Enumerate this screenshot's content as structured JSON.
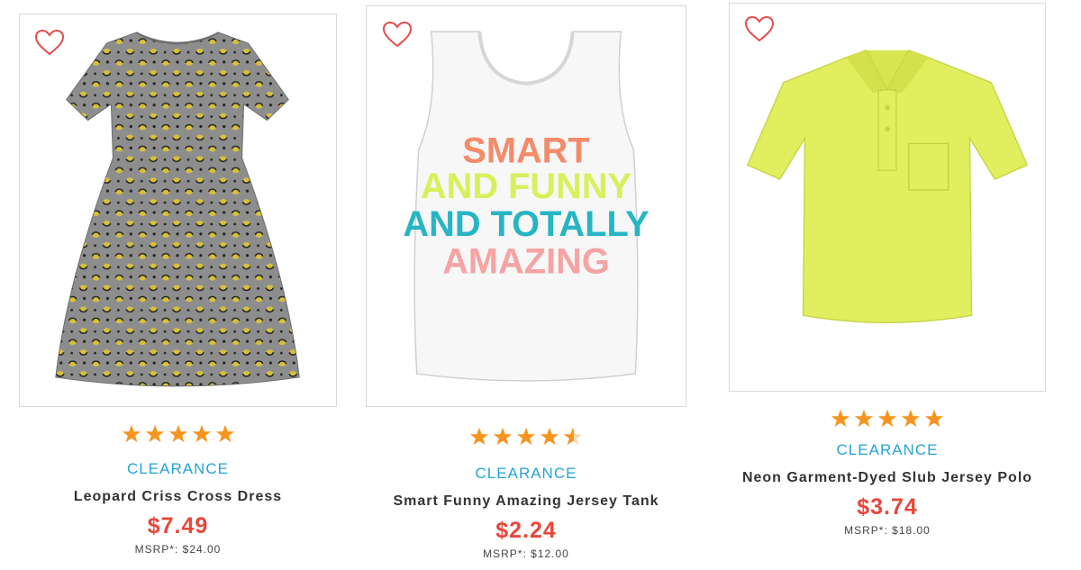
{
  "products": [
    {
      "name": "Leopard Criss Cross Dress",
      "badge": "CLEARANCE",
      "price": "$7.49",
      "msrp": "MSRP*: $24.00",
      "rating": 5,
      "image_icon": "leopard-dress-image"
    },
    {
      "name": "Smart Funny Amazing Jersey Tank",
      "badge": "CLEARANCE",
      "price": "$2.24",
      "msrp": "MSRP*: $12.00",
      "rating": 4.5,
      "image_icon": "graphic-tank-image",
      "print_lines": [
        "SMART",
        "AND FUNNY",
        "AND TOTALLY",
        "AMAZING"
      ]
    },
    {
      "name": "Neon Garment-Dyed Slub Jersey Polo",
      "badge": "CLEARANCE",
      "price": "$3.74",
      "msrp": "MSRP*: $18.00",
      "rating": 5,
      "image_icon": "neon-polo-image"
    }
  ],
  "colors": {
    "star": "#f7941d",
    "clearance": "#26a3d5",
    "price": "#e8473b",
    "heart": "#e54b4b"
  }
}
